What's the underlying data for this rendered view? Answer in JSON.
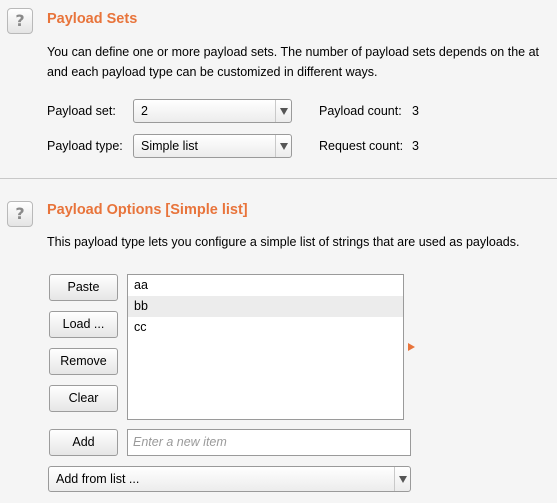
{
  "payload_sets": {
    "help_icon": "?",
    "title": "Payload Sets",
    "description_line1": "You can define one or more payload sets. The number of payload sets depends on the at",
    "description_line2": "and each payload type can be customized in different ways.",
    "payload_set_label": "Payload set:",
    "payload_set_value": "2",
    "payload_type_label": "Payload type:",
    "payload_type_value": "Simple list",
    "payload_count_label": "Payload count:",
    "payload_count_value": "3",
    "request_count_label": "Request count:",
    "request_count_value": "3"
  },
  "payload_options": {
    "help_icon": "?",
    "title": "Payload Options [Simple list]",
    "description": "This payload type lets you configure a simple list of strings that are used as payloads.",
    "buttons": {
      "paste": "Paste",
      "load": "Load ...",
      "remove": "Remove",
      "clear": "Clear",
      "add": "Add"
    },
    "items": [
      "aa",
      "bb",
      "cc"
    ],
    "new_item_placeholder": "Enter a new item",
    "add_from_list": "Add from list ..."
  },
  "colors": {
    "accent": "#e8743b",
    "background": "#f5f5f5"
  }
}
